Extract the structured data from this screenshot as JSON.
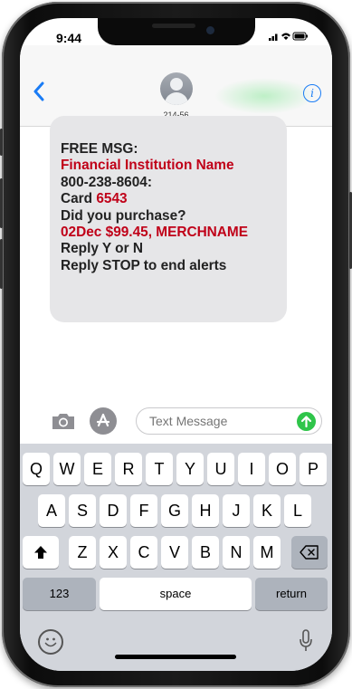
{
  "status": {
    "time": "9:44",
    "icons": "..l ≋ ▬"
  },
  "header": {
    "back_icon": "chevron-left-icon",
    "contact": "214-56",
    "info_icon": "info-icon"
  },
  "message": {
    "line1": "FREE MSG:",
    "line2": "Financial Institution Name",
    "line3": "800-238-8604:",
    "line4_prefix": "Card",
    "line4_value": "6543",
    "line5": "Did you purchase?",
    "line6": "02Dec $99.45, MERCHNAME",
    "line7": "Reply Y or N",
    "line8": "Reply STOP to end alerts"
  },
  "compose": {
    "placeholder": "Text Message",
    "send_icon": "arrow-up-icon",
    "camera_icon": "camera-icon",
    "apps_icon": "app-store-icon"
  },
  "keyboard": {
    "row1": [
      "Q",
      "W",
      "E",
      "R",
      "T",
      "Y",
      "U",
      "I",
      "O",
      "P"
    ],
    "row2": [
      "A",
      "S",
      "D",
      "F",
      "G",
      "H",
      "J",
      "K",
      "L"
    ],
    "row3": [
      "Z",
      "X",
      "C",
      "V",
      "B",
      "N",
      "M"
    ],
    "numbers": "123",
    "space": "space",
    "return": "return",
    "shift_icon": "shift-icon",
    "delete_icon": "delete-icon",
    "emoji_icon": "emoji-icon",
    "mic_icon": "microphone-icon"
  },
  "colors": {
    "accent": "#1a7cf5",
    "alert_red": "#c00018",
    "send_green": "#2fc54a",
    "bubble": "#e6e6e8"
  }
}
